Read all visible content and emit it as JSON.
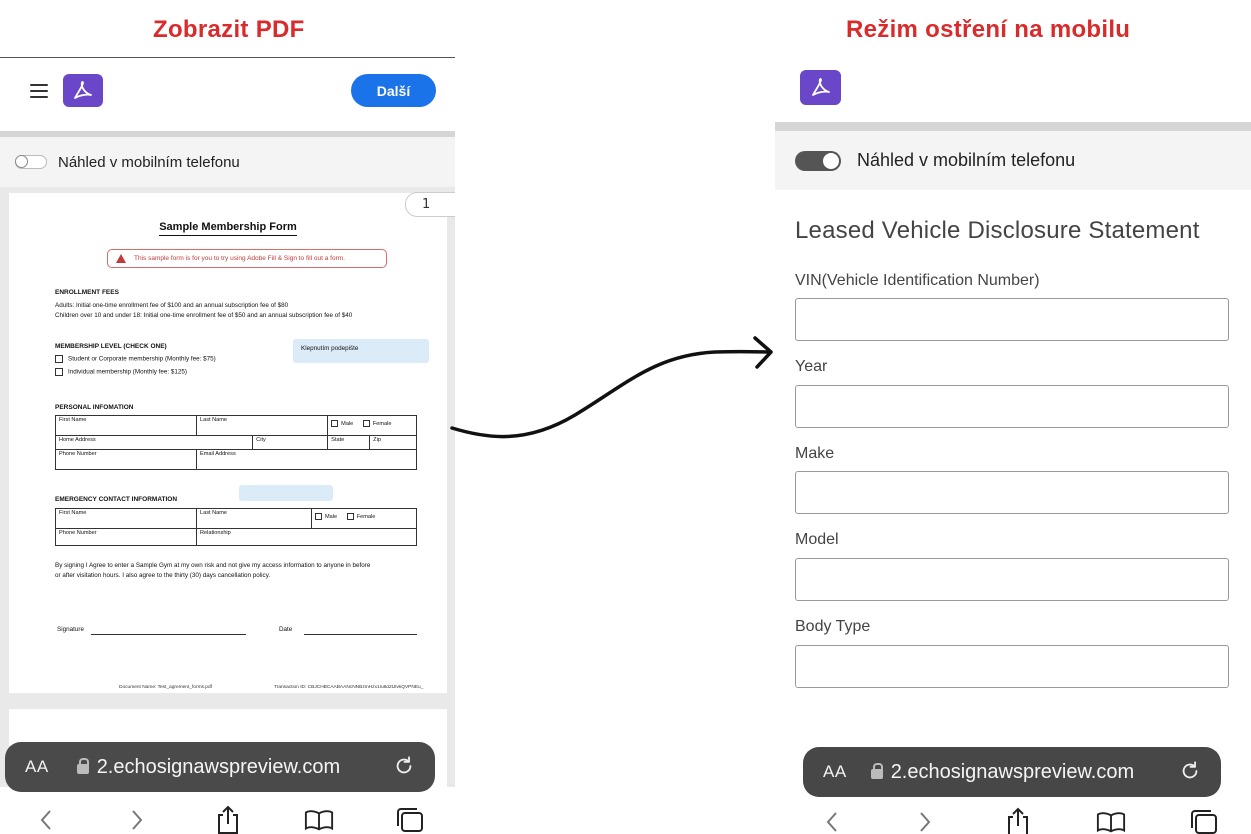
{
  "captions": {
    "left": "Zobrazit PDF",
    "right": "Režim ostření na mobilu"
  },
  "left_phone": {
    "header": {
      "next_button": "Další"
    },
    "toggle": {
      "label": "Náhled v mobilním telefonu",
      "on": false
    },
    "page_number": "1",
    "pdf": {
      "title": "Sample Membership Form",
      "notice": "This sample form is for you to try using Adobe Fill & Sign to fill out a form.",
      "enrollment_heading": "ENROLLMENT FEES",
      "enrollment_lines": [
        "Adults: Initial one-time enrollment fee of $100 and an annual subscription fee of $80",
        "Children over 10 and under 18: Initial one-time enrollment fee of $50 and an annual subscription fee of $40"
      ],
      "membership_heading": "MEMBERSHIP LEVEL (CHECK ONE)",
      "membership_options": [
        "Student or Corporate membership (Monthly fee: $75)",
        "Individual membership (Monthly fee: $125)"
      ],
      "sign_hint": "Klepnutím podepište",
      "personal_heading": "PERSONAL INFOMATION",
      "personal_fields": {
        "first_name": "First Name",
        "last_name": "Last Name",
        "male": "Male",
        "female": "Female",
        "home_address": "Home Address",
        "city": "City",
        "state": "State",
        "zip": "Zip",
        "phone": "Phone Number",
        "email": "Email Address"
      },
      "emergency_heading": "EMERGENCY CONTACT INFORMATION",
      "emergency_fields": {
        "first_name": "First Name",
        "last_name": "Last Name",
        "male": "Male",
        "female": "Female",
        "phone": "Phone Number",
        "relationship": "Relationship"
      },
      "agreement_lines": [
        "By signing I Agree to enter a Sample Gym at my own risk and not give my access information to anyone in before",
        "or after visitation hours. I also agree to the thirty (30) days cancellation policy."
      ],
      "signature_label": "Signature",
      "date_label": "Date",
      "footer_doc": "Document Name: Test_agrement_forms.pdf",
      "footer_tx": "Transaction ID: CBJCHBCAABAANcNNBzmHzx1Iu8d2tJlvkQVPNEu_"
    },
    "browser": {
      "aa": "AA",
      "url": "2.echosignawspreview.com"
    }
  },
  "right_phone": {
    "toggle": {
      "label": "Náhled v mobilním telefonu",
      "on": true
    },
    "form": {
      "title": "Leased Vehicle Disclosure Statement",
      "fields": [
        "VIN(Vehicle Identification Number)",
        "Year",
        "Make",
        "Model",
        "Body Type"
      ]
    },
    "browser": {
      "aa": "AA",
      "url": "2.echosignawspreview.com"
    }
  },
  "colors": {
    "caption": "#d92b2b",
    "acrobat": "#6a46c9",
    "primary_button": "#1a73e8"
  }
}
